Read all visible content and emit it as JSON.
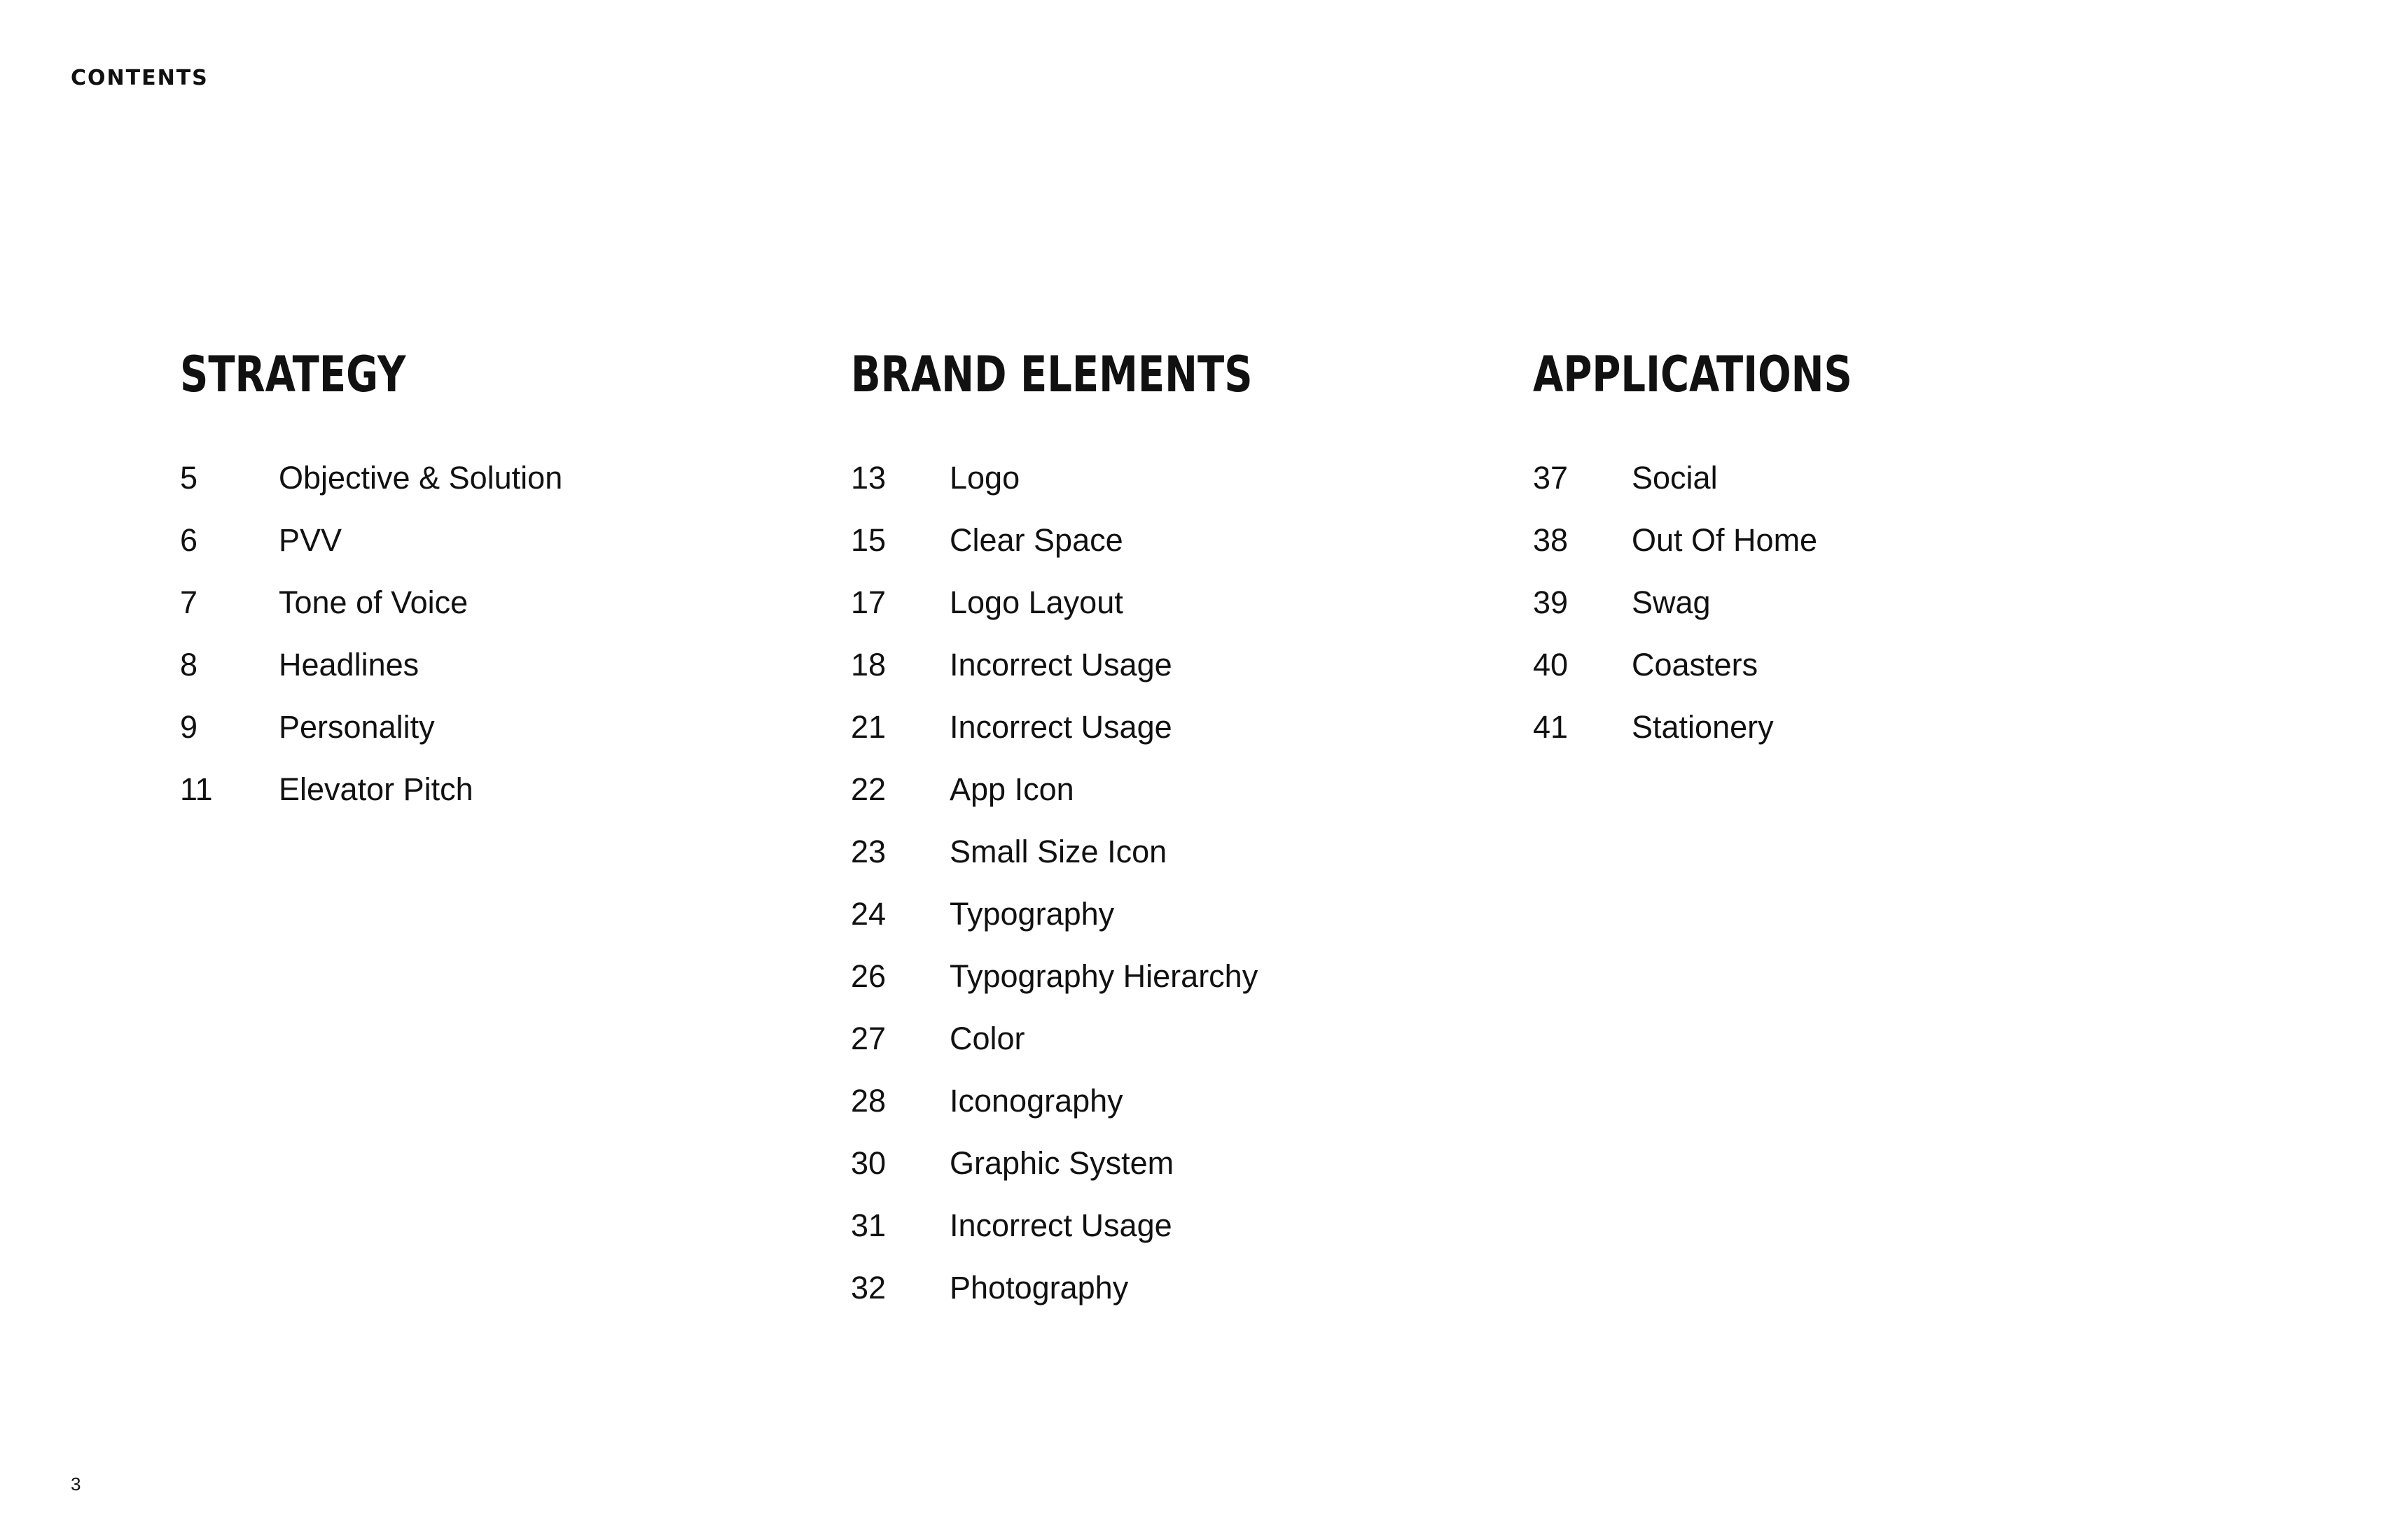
{
  "header": {
    "label": "CONTENTS"
  },
  "sections": [
    {
      "title": "STRATEGY",
      "items": [
        {
          "page": "5",
          "title": "Objective & Solution"
        },
        {
          "page": "6",
          "title": "PVV"
        },
        {
          "page": "7",
          "title": "Tone of Voice"
        },
        {
          "page": "8",
          "title": "Headlines"
        },
        {
          "page": "9",
          "title": "Personality"
        },
        {
          "page": "11",
          "title": "Elevator Pitch"
        }
      ]
    },
    {
      "title": "BRAND ELEMENTS",
      "items": [
        {
          "page": "13",
          "title": "Logo"
        },
        {
          "page": "15",
          "title": "Clear Space"
        },
        {
          "page": "17",
          "title": "Logo Layout"
        },
        {
          "page": "18",
          "title": "Incorrect Usage"
        },
        {
          "page": "21",
          "title": "Incorrect Usage"
        },
        {
          "page": "22",
          "title": "App Icon"
        },
        {
          "page": "23",
          "title": "Small Size Icon"
        },
        {
          "page": "24",
          "title": "Typography"
        },
        {
          "page": "26",
          "title": "Typography Hierarchy"
        },
        {
          "page": "27",
          "title": "Color"
        },
        {
          "page": "28",
          "title": "Iconography"
        },
        {
          "page": "30",
          "title": "Graphic System"
        },
        {
          "page": "31",
          "title": "Incorrect Usage"
        },
        {
          "page": "32",
          "title": "Photography"
        }
      ]
    },
    {
      "title": "APPLICATIONS",
      "items": [
        {
          "page": "37",
          "title": "Social"
        },
        {
          "page": "38",
          "title": "Out Of Home"
        },
        {
          "page": "39",
          "title": "Swag"
        },
        {
          "page": "40",
          "title": "Coasters"
        },
        {
          "page": "41",
          "title": "Stationery"
        }
      ]
    }
  ],
  "footer": {
    "page_number": "3"
  }
}
